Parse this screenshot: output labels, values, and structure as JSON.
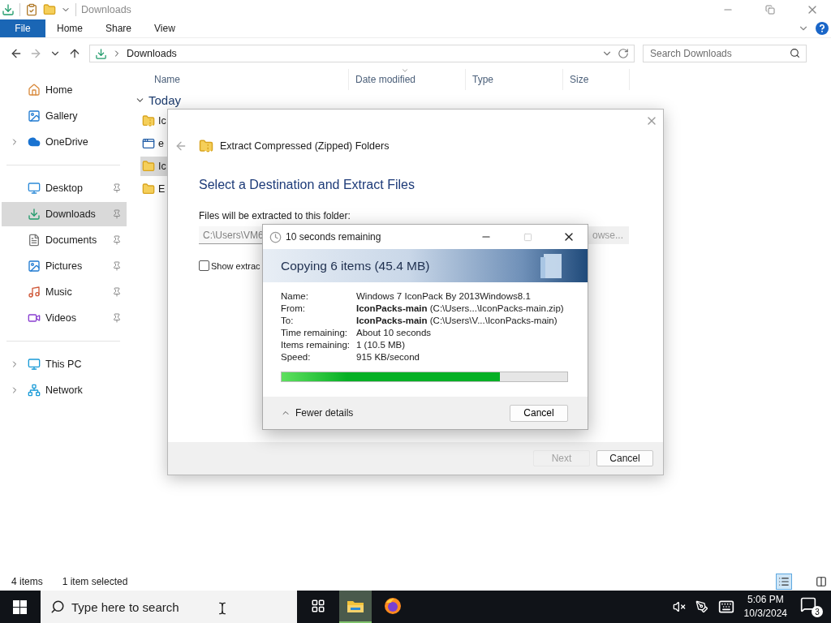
{
  "window": {
    "title": "Downloads"
  },
  "ribbon": {
    "file_button": "File",
    "tabs": [
      "Home",
      "Share",
      "View"
    ]
  },
  "address_bar": {
    "path": "Downloads"
  },
  "search": {
    "placeholder": "Search Downloads"
  },
  "nav": {
    "sections": [
      {
        "items": [
          {
            "label": "Home",
            "kind": "home",
            "expandable": false,
            "pinned": false,
            "selected": false
          },
          {
            "label": "Gallery",
            "kind": "gallery",
            "expandable": false,
            "pinned": false,
            "selected": false
          },
          {
            "label": "OneDrive",
            "kind": "cloud",
            "expandable": true,
            "pinned": false,
            "selected": false
          }
        ]
      },
      {
        "items": [
          {
            "label": "Desktop",
            "kind": "desktop",
            "expandable": false,
            "pinned": true,
            "selected": false
          },
          {
            "label": "Downloads",
            "kind": "downloads",
            "expandable": false,
            "pinned": true,
            "selected": true
          },
          {
            "label": "Documents",
            "kind": "documents",
            "expandable": false,
            "pinned": true,
            "selected": false
          },
          {
            "label": "Pictures",
            "kind": "pictures",
            "expandable": false,
            "pinned": true,
            "selected": false
          },
          {
            "label": "Music",
            "kind": "music",
            "expandable": false,
            "pinned": true,
            "selected": false
          },
          {
            "label": "Videos",
            "kind": "videos",
            "expandable": false,
            "pinned": true,
            "selected": false
          }
        ]
      },
      {
        "items": [
          {
            "label": "This PC",
            "kind": "pc",
            "expandable": true,
            "pinned": false,
            "selected": false
          },
          {
            "label": "Network",
            "kind": "network",
            "expandable": true,
            "pinned": false,
            "selected": false
          }
        ]
      }
    ]
  },
  "file_list": {
    "columns": [
      "Name",
      "Date modified",
      "Type",
      "Size"
    ],
    "group": {
      "label": "Today",
      "expanded": true
    },
    "files": [
      {
        "name": "Ic",
        "kind": "zip",
        "selected": false
      },
      {
        "name": "e",
        "kind": "app",
        "selected": false
      },
      {
        "name": "Ic",
        "kind": "folder",
        "selected": true
      },
      {
        "name": "E",
        "kind": "folder",
        "selected": false
      }
    ]
  },
  "status_bar": {
    "item_count": "4 items",
    "selection": "1 item selected",
    "views": [
      {
        "kind": "details",
        "selected": true
      },
      {
        "kind": "tiles",
        "selected": false
      }
    ]
  },
  "extract_dialog": {
    "title": "Extract Compressed (Zipped) Folders",
    "heading": "Select a Destination and Extract Files",
    "folder_label": "Files will be extracted to this folder:",
    "folder_path": "C:\\Users\\VM6",
    "browse": "owse...",
    "show_files": {
      "label": "Show extrac",
      "checked": false
    },
    "buttons": [
      {
        "label": "Next",
        "disabled": true
      },
      {
        "label": "Cancel",
        "disabled": false
      }
    ]
  },
  "copy_dialog": {
    "title": "10 seconds remaining",
    "heading": "Copying 6 items (45.4 MB)",
    "details": [
      {
        "label": "Name:",
        "value": "Windows 7 IconPack By 2013Windows8.1"
      },
      {
        "label": "From:",
        "value": "**IconPacks-main** (C:\\Users...\\IconPacks-main.zip)"
      },
      {
        "label": "To:",
        "value": "**IconPacks-main** (C:\\Users\\V...\\IconPacks-main)"
      },
      {
        "label": "Time remaining:",
        "value": "About 10 seconds"
      },
      {
        "label": "Items remaining:",
        "value": "1 (10.5 MB)"
      },
      {
        "label": "Speed:",
        "value": "915 KB/second"
      }
    ],
    "progress": {
      "level": 0.765
    },
    "details_toggle": "Fewer details",
    "cancel": "Cancel"
  },
  "taskbar": {
    "search_placeholder": "Type here to search",
    "apps": [
      {
        "kind": "task-view",
        "active": false
      },
      {
        "kind": "explorer",
        "active": true
      },
      {
        "kind": "firefox",
        "active": false
      }
    ],
    "time": "5:06 PM",
    "date": "10/3/2024",
    "notification_count": "3"
  }
}
